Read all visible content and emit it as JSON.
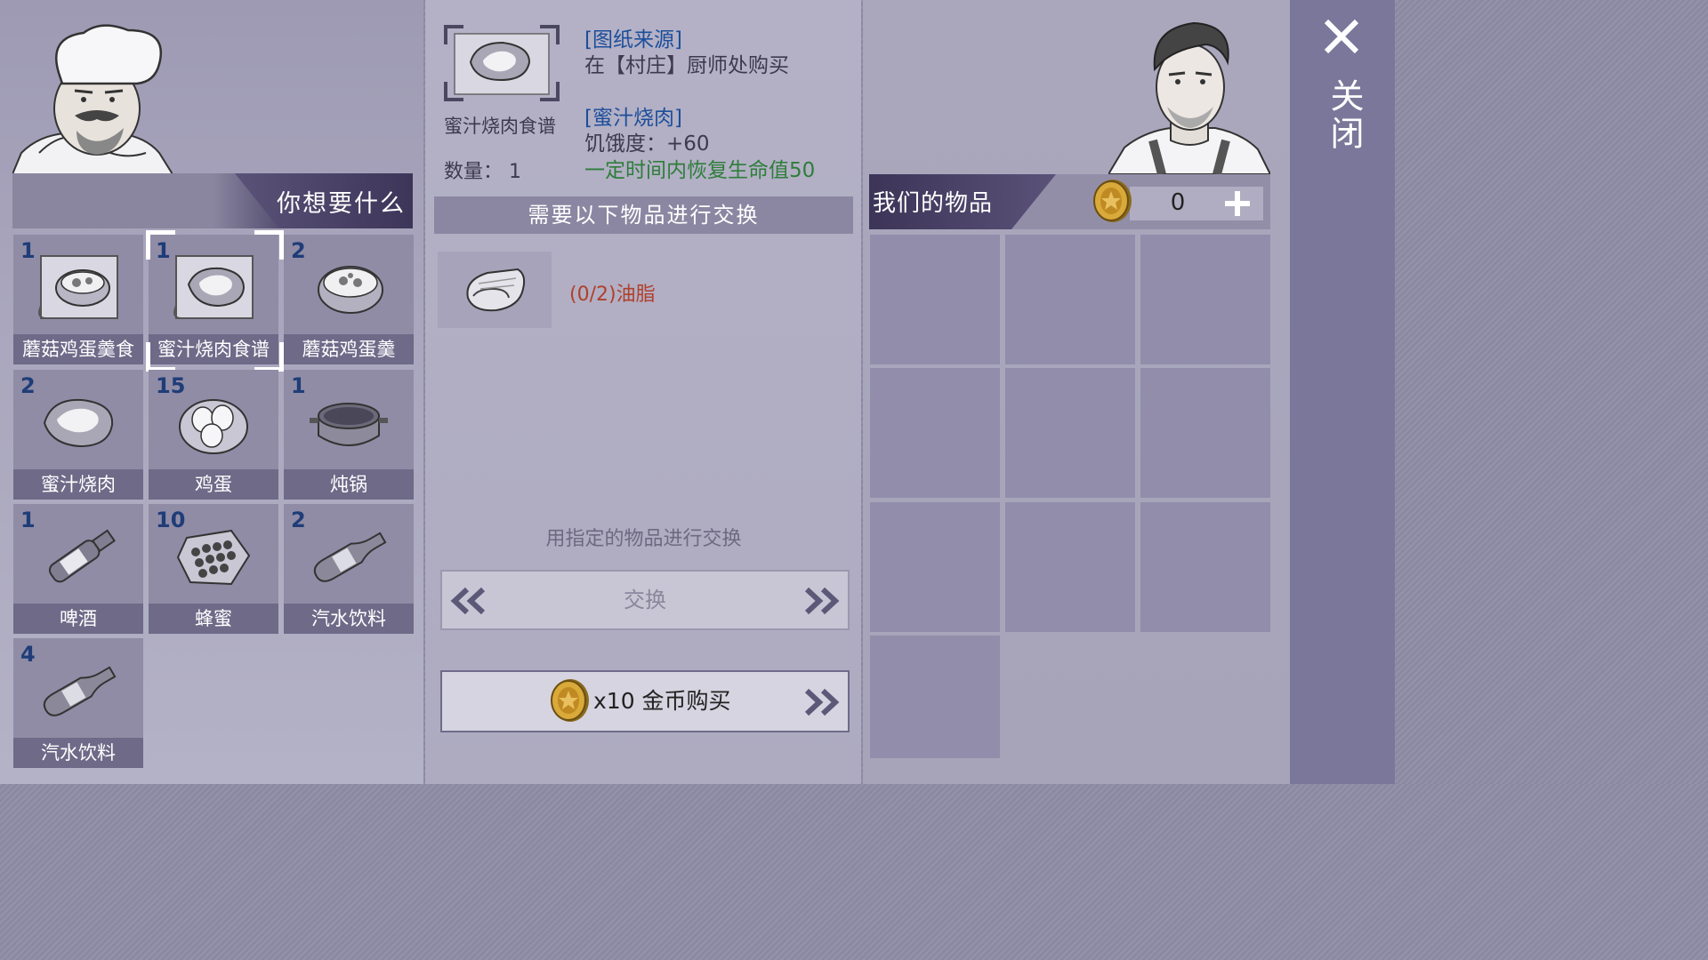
{
  "merchant": {
    "header_title": "你想要什么",
    "items": [
      {
        "qty": "1",
        "label": "蘑菇鸡蛋羹食",
        "icon": "recipe-scroll-stew-icon",
        "selected": false
      },
      {
        "qty": "1",
        "label": "蜜汁烧肉食谱",
        "icon": "recipe-scroll-meat-icon",
        "selected": true
      },
      {
        "qty": "2",
        "label": "蘑菇鸡蛋羹",
        "icon": "egg-custard-bowl-icon",
        "selected": false
      },
      {
        "qty": "2",
        "label": "蜜汁烧肉",
        "icon": "honey-meat-icon",
        "selected": false
      },
      {
        "qty": "15",
        "label": "鸡蛋",
        "icon": "eggs-icon",
        "selected": false
      },
      {
        "qty": "1",
        "label": "炖锅",
        "icon": "stew-pot-icon",
        "selected": false
      },
      {
        "qty": "1",
        "label": "啤酒",
        "icon": "beer-bottle-icon",
        "selected": false
      },
      {
        "qty": "10",
        "label": "蜂蜜",
        "icon": "honeycomb-icon",
        "selected": false
      },
      {
        "qty": "2",
        "label": "汽水饮料",
        "icon": "soda-bottle-icon",
        "selected": false
      },
      {
        "qty": "4",
        "label": "汽水饮料",
        "icon": "soda-bottle-icon",
        "selected": false
      }
    ]
  },
  "detail": {
    "recipe_name": "蜜汁烧肉食谱",
    "quantity_label": "数量：",
    "quantity_value": "1",
    "source_heading": "[图纸来源]",
    "source_text": "在【村庄】厨师处购买",
    "product_heading": "[蜜汁烧肉]",
    "hunger_text": "饥饿度：+60",
    "effect_text": "一定时间内恢复生命值50",
    "exchange_header": "需要以下物品进行交换",
    "requirement_text": "(0/2)油脂",
    "hint_text": "用指定的物品进行交换",
    "exchange_button_label": "交换",
    "buy_price_label": "x10 金币购买"
  },
  "inventory": {
    "header_title": "我们的物品",
    "coin_count": "0"
  },
  "close_label": "关闭",
  "colors": {
    "accent_blue": "#1c4e9a",
    "effect_green": "#2e7d3a",
    "requirement_red": "#b0402b",
    "header_purple": "#3c3558"
  }
}
